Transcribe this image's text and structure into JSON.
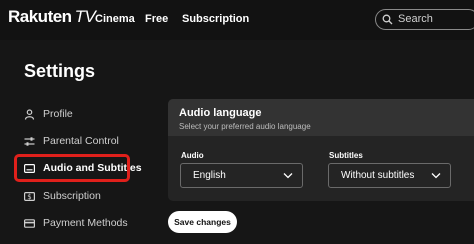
{
  "header": {
    "logo_text": "Rakuten",
    "logo_suffix": "TV",
    "nav": [
      "Cinema",
      "Free",
      "Subscription"
    ],
    "search_placeholder": "Search"
  },
  "page_title": "Settings",
  "sidebar": {
    "items": [
      {
        "label": "Profile",
        "icon": "person-icon"
      },
      {
        "label": "Parental Control",
        "icon": "sliders-icon"
      },
      {
        "label": "Audio and Subtitles",
        "icon": "subtitles-icon",
        "active": true
      },
      {
        "label": "Subscription",
        "icon": "dollar-icon"
      },
      {
        "label": "Payment Methods",
        "icon": "credit-card-icon"
      }
    ]
  },
  "audio_section": {
    "title": "Audio language",
    "subtitle": "Select your preferred audio language",
    "audio_label": "Audio",
    "audio_value": "English",
    "subtitles_label": "Subtitles",
    "subtitles_value": "Without subtitles"
  },
  "save_button": "Save changes",
  "colors": {
    "background": "#161616",
    "card": "#242424",
    "card_header": "#333333",
    "highlight": "#e0201b"
  }
}
